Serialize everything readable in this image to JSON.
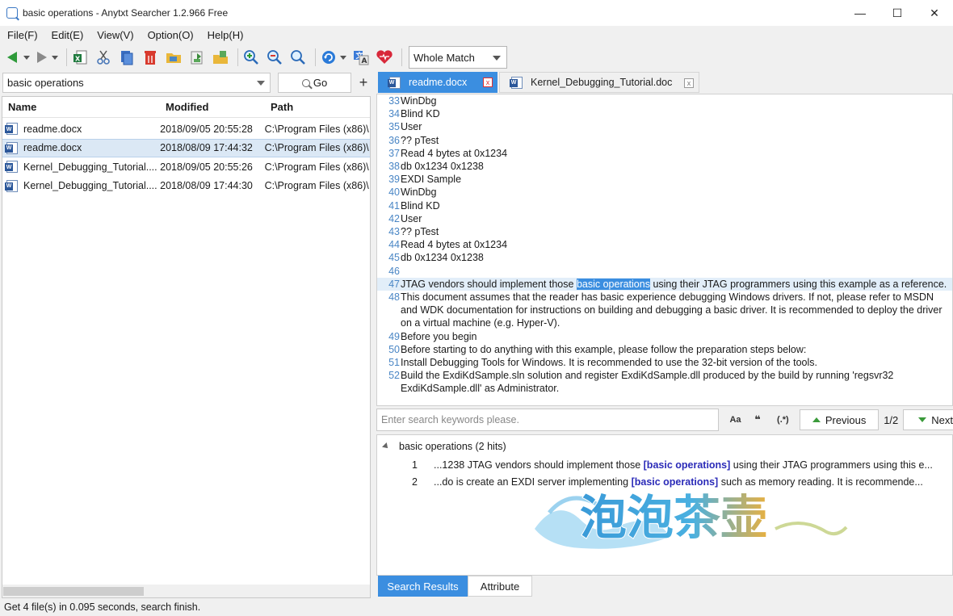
{
  "window": {
    "title": "basic operations - Anytxt Searcher 1.2.966 Free",
    "minimize": "—",
    "maximize": "☐",
    "close": "✕"
  },
  "menu": [
    "File(F)",
    "Edit(E)",
    "View(V)",
    "Option(O)",
    "Help(H)"
  ],
  "toolbar": {
    "match_mode": "Whole Match"
  },
  "search": {
    "query": "basic operations",
    "go_label": "Go",
    "add_label": "+"
  },
  "files": {
    "columns": [
      "Name",
      "Modified",
      "Path"
    ],
    "rows": [
      {
        "name": "readme.docx",
        "modified": "2018/09/05 20:55:28",
        "path": "C:\\Program Files (x86)\\"
      },
      {
        "name": "readme.docx",
        "modified": "2018/08/09 17:44:32",
        "path": "C:\\Program Files (x86)\\"
      },
      {
        "name": "Kernel_Debugging_Tutorial....",
        "modified": "2018/09/05 20:55:26",
        "path": "C:\\Program Files (x86)\\"
      },
      {
        "name": "Kernel_Debugging_Tutorial....",
        "modified": "2018/08/09 17:44:30",
        "path": "C:\\Program Files (x86)\\"
      }
    ]
  },
  "doc_tabs": [
    {
      "label": "readme.docx",
      "close": "x"
    },
    {
      "label": "Kernel_Debugging_Tutorial.doc",
      "close": "x"
    }
  ],
  "preview": {
    "lines": [
      {
        "n": "33",
        "t": "WinDbg"
      },
      {
        "n": "34",
        "t": "Blind KD"
      },
      {
        "n": "35",
        "t": "User"
      },
      {
        "n": "36",
        "t": "?? pTest"
      },
      {
        "n": "37",
        "t": "Read 4 bytes at 0x1234"
      },
      {
        "n": "38",
        "t": "db 0x1234 0x1238"
      },
      {
        "n": "39",
        "t": "EXDI Sample"
      },
      {
        "n": "40",
        "t": "WinDbg"
      },
      {
        "n": "41",
        "t": "Blind KD"
      },
      {
        "n": "42",
        "t": "User"
      },
      {
        "n": "43",
        "t": "?? pTest"
      },
      {
        "n": "44",
        "t": "Read 4 bytes at 0x1234"
      },
      {
        "n": "45",
        "t": "db 0x1234 0x1238"
      },
      {
        "n": "46",
        "t": ""
      }
    ],
    "line47": {
      "n": "47",
      "before": "JTAG vendors should implement those ",
      "highlight": "basic operations",
      "after": " using their JTAG programmers using this example as a reference."
    },
    "lines_after": [
      {
        "n": "48",
        "t": "This document assumes that the reader has basic experience debugging Windows drivers. If not, please refer to MSDN and WDK documentation for instructions on building and debugging a basic driver. It is recommended to deploy the driver on a virtual machine (e.g. Hyper-V)."
      },
      {
        "n": "49",
        "t": "Before you begin"
      },
      {
        "n": "50",
        "t": "Before starting to do anything with this example, please follow the preparation steps below:"
      },
      {
        "n": "51",
        "t": "Install Debugging Tools for Windows. It is recommended to use the 32-bit version of the tools."
      },
      {
        "n": "52",
        "t": "Build the ExdiKdSample.sln solution and register ExdiKdSample.dll produced by the build by running 'regsvr32 ExdiKdSample.dll' as Administrator."
      }
    ]
  },
  "findbar": {
    "placeholder": "Enter search keywords please.",
    "opt_case": "Aa",
    "opt_word": "❝",
    "opt_regex": "(.*)",
    "previous": "Previous",
    "counter": "1/2",
    "next": "Next"
  },
  "results": {
    "group": "basic operations (2 hits)",
    "rows": [
      {
        "num": "1",
        "before": "...1238 JTAG vendors should implement those ",
        "kw": "[basic operations]",
        "after": " using their JTAG programmers using this e..."
      },
      {
        "num": "2",
        "before": "...do is create an EXDI server implementing ",
        "kw": "[basic operations]",
        "after": " such as memory reading. It is recommende..."
      }
    ]
  },
  "watermark": {
    "text": "泡泡茶壶"
  },
  "bottom_tabs": [
    "Search Results",
    "Attribute"
  ],
  "status": "Get 4 file(s) in 0.095 seconds, search finish."
}
